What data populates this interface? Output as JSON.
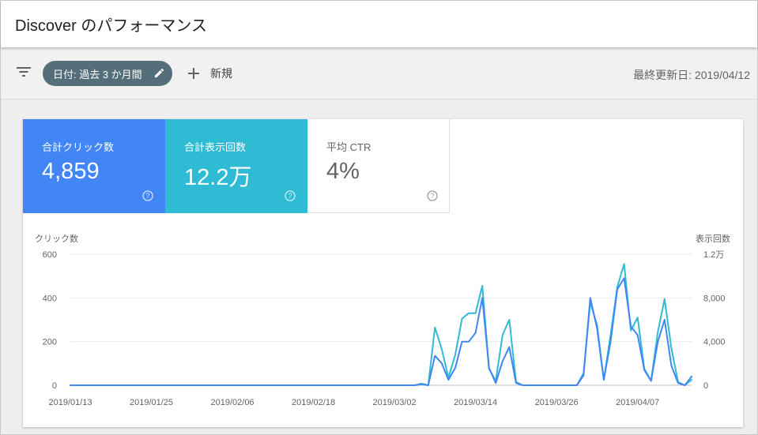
{
  "header": {
    "title": "Discover のパフォーマンス"
  },
  "toolbar": {
    "date_filter_label": "日付: 過去 3 か月間",
    "new_label": "新規",
    "last_updated": "最終更新日: 2019/04/12"
  },
  "metrics": [
    {
      "label": "合計クリック数",
      "value": "4,859",
      "color": "#4285f4"
    },
    {
      "label": "合計表示回数",
      "value": "12.2万",
      "color": "#2ebbd3"
    },
    {
      "label": "平均 CTR",
      "value": "4%"
    }
  ],
  "icons": [
    "filter-icon",
    "pencil-icon",
    "plus-icon",
    "help-icon"
  ],
  "chart_data": {
    "type": "line",
    "left_axis_label": "クリック数",
    "right_axis_label": "表示回数",
    "left_ticks": [
      "600",
      "400",
      "200",
      "0"
    ],
    "right_ticks": [
      "1.2万",
      "8,000",
      "4,000",
      "0"
    ],
    "ylim_left": [
      0,
      600
    ],
    "ylim_right": [
      0,
      12000
    ],
    "grid": true,
    "x_tick_labels": [
      "2019/01/13",
      "2019/01/25",
      "2019/02/06",
      "2019/02/18",
      "2019/03/02",
      "2019/03/14",
      "2019/03/26",
      "2019/04/07"
    ],
    "x_start": "2019/01/13",
    "x_end": "2019/04/11",
    "series": [
      {
        "name": "クリック数",
        "axis": "left",
        "color": "#4285f4",
        "values": [
          0,
          0,
          0,
          0,
          0,
          0,
          0,
          0,
          0,
          0,
          0,
          0,
          0,
          0,
          0,
          0,
          0,
          0,
          0,
          0,
          0,
          0,
          0,
          0,
          0,
          0,
          0,
          0,
          0,
          0,
          0,
          0,
          0,
          0,
          0,
          0,
          0,
          0,
          0,
          0,
          0,
          0,
          0,
          0,
          0,
          0,
          0,
          0,
          0,
          0,
          0,
          0,
          5,
          0,
          135,
          100,
          25,
          80,
          200,
          200,
          240,
          400,
          80,
          10,
          110,
          175,
          10,
          0,
          0,
          0,
          0,
          0,
          0,
          0,
          0,
          0,
          45,
          400,
          260,
          25,
          200,
          440,
          490,
          270,
          230,
          70,
          20,
          200,
          300,
          90,
          10,
          0,
          40
        ]
      },
      {
        "name": "表示回数",
        "axis": "right",
        "color": "#2ebbd3",
        "values": [
          0,
          0,
          0,
          0,
          0,
          0,
          0,
          0,
          0,
          0,
          0,
          0,
          0,
          0,
          0,
          0,
          0,
          0,
          0,
          0,
          0,
          0,
          0,
          0,
          0,
          0,
          0,
          0,
          0,
          0,
          0,
          0,
          0,
          0,
          0,
          0,
          0,
          0,
          0,
          0,
          0,
          0,
          0,
          0,
          0,
          0,
          0,
          0,
          0,
          0,
          0,
          0,
          150,
          0,
          5300,
          3300,
          700,
          2800,
          6100,
          6600,
          6600,
          9100,
          1500,
          400,
          4600,
          6000,
          300,
          0,
          0,
          0,
          0,
          0,
          0,
          0,
          0,
          0,
          1100,
          7600,
          5500,
          500,
          4600,
          9000,
          11100,
          5000,
          6200,
          1500,
          400,
          4900,
          7900,
          3400,
          300,
          0,
          500
        ]
      }
    ]
  }
}
